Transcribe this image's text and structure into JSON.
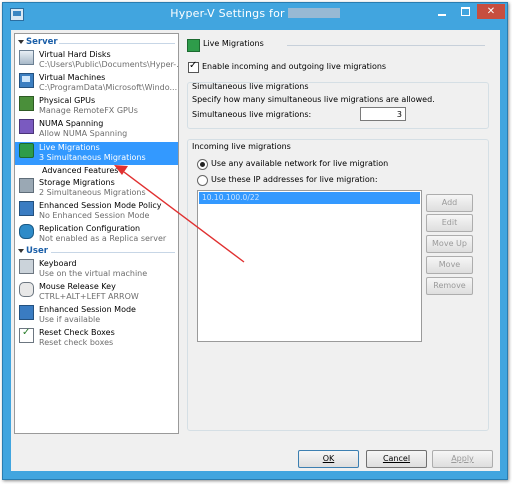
{
  "window": {
    "title": "Hyper-V Settings for"
  },
  "nav": {
    "server_header": "Server",
    "user_header": "User",
    "items": [
      {
        "label": "Virtual Hard Disks",
        "sub": "C:\\Users\\Public\\Documents\\Hyper-..."
      },
      {
        "label": "Virtual Machines",
        "sub": "C:\\ProgramData\\Microsoft\\Windo..."
      },
      {
        "label": "Physical GPUs",
        "sub": "Manage RemoteFX GPUs"
      },
      {
        "label": "NUMA Spanning",
        "sub": "Allow NUMA Spanning"
      },
      {
        "label": "Live Migrations",
        "sub": "3 Simultaneous Migrations"
      },
      {
        "label": "Advanced Features",
        "sub": ""
      },
      {
        "label": "Storage Migrations",
        "sub": "2 Simultaneous Migrations"
      },
      {
        "label": "Enhanced Session Mode Policy",
        "sub": "No Enhanced Session Mode"
      },
      {
        "label": "Replication Configuration",
        "sub": "Not enabled as a Replica server"
      }
    ],
    "user_items": [
      {
        "label": "Keyboard",
        "sub": "Use on the virtual machine"
      },
      {
        "label": "Mouse Release Key",
        "sub": "CTRL+ALT+LEFT ARROW"
      },
      {
        "label": "Enhanced Session Mode",
        "sub": "Use if available"
      },
      {
        "label": "Reset Check Boxes",
        "sub": "Reset check boxes"
      }
    ]
  },
  "panel": {
    "header": "Live Migrations",
    "enable_label": "Enable incoming and outgoing live migrations",
    "enable_checked": true,
    "simultaneous": {
      "title": "Simultaneous live migrations",
      "description": "Specify how many simultaneous live migrations are allowed.",
      "field_label": "Simultaneous live migrations:",
      "value": "3"
    },
    "incoming": {
      "title": "Incoming live migrations",
      "option_any": "Use any available network for live migration",
      "option_these": "Use these IP addresses for live migration:",
      "selected_option": "any",
      "addresses": [
        "10.10.100.0/22"
      ],
      "buttons": {
        "add": "Add",
        "edit": "Edit",
        "move_up": "Move Up",
        "move_down": "Move Down",
        "remove": "Remove"
      }
    }
  },
  "footer": {
    "ok": "OK",
    "cancel": "Cancel",
    "apply": "Apply"
  },
  "colors": {
    "title_bar": "#41a5df",
    "selection": "#3399ff",
    "section_header": "#1b5fa8",
    "close_button": "#c74e3f",
    "annotation_arrow": "#e03030"
  }
}
